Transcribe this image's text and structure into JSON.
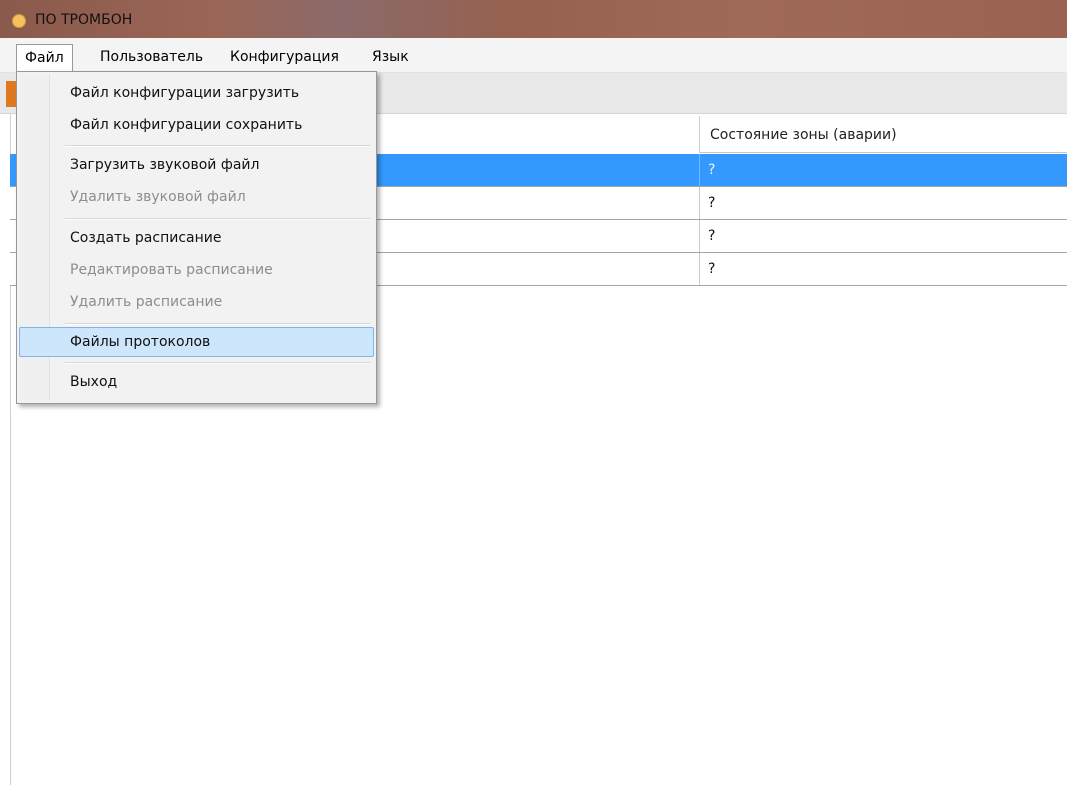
{
  "window": {
    "title": "ПО ТРОМБОН"
  },
  "menubar": {
    "items": [
      {
        "label": "Файл"
      },
      {
        "label": "Пользователь"
      },
      {
        "label": "Конфигурация"
      },
      {
        "label": "Язык"
      }
    ]
  },
  "grid": {
    "column_header": "Состояние зоны (аварии)",
    "rows": [
      {
        "status": "?",
        "selected": true
      },
      {
        "status": "?",
        "selected": false
      },
      {
        "status": "?",
        "selected": false
      },
      {
        "status": "?",
        "selected": false
      }
    ]
  },
  "file_menu": {
    "items": [
      {
        "label": "Файл конфигурации загрузить",
        "enabled": true
      },
      {
        "label": "Файл конфигурации сохранить",
        "enabled": true
      },
      {
        "label": "Загрузить звуковой файл",
        "enabled": true
      },
      {
        "label": "Удалить звуковой файл",
        "enabled": false
      },
      {
        "label": "Создать расписание",
        "enabled": true
      },
      {
        "label": "Редактировать расписание",
        "enabled": false
      },
      {
        "label": "Удалить расписание",
        "enabled": false
      },
      {
        "label": "Файлы протоколов",
        "enabled": true,
        "highlighted": true
      },
      {
        "label": "Выход",
        "enabled": true
      }
    ]
  },
  "colors": {
    "title_bar": "#96614f",
    "selection": "#3399ff",
    "menu_highlight": "#cde6fb",
    "accent_orange": "#e07820"
  }
}
